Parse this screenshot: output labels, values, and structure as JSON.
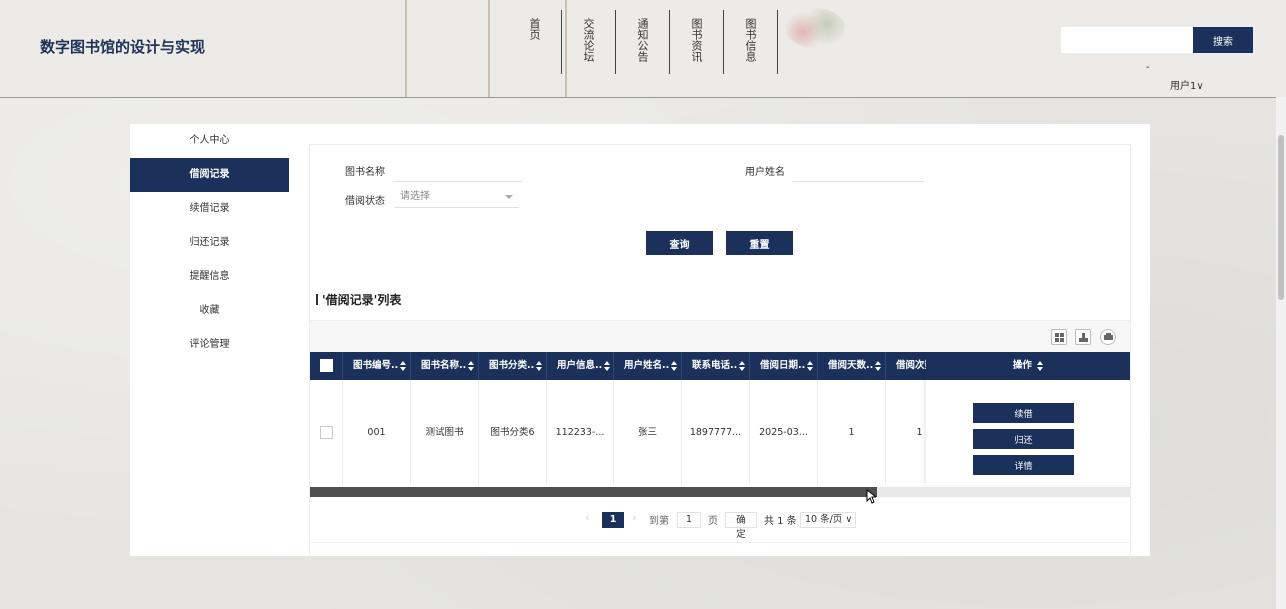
{
  "header": {
    "site_title": "数字图书馆的设计与实现",
    "nav": [
      "首页",
      "交流论坛",
      "通知公告",
      "图书资讯",
      "图书信息"
    ],
    "search_placeholder": "",
    "search_button": "搜索",
    "dash": "-",
    "user_menu": "用户1∨"
  },
  "sidebar": {
    "items": [
      "个人中心",
      "借阅记录",
      "续借记录",
      "归还记录",
      "提醒信息",
      "收藏",
      "评论管理"
    ],
    "active_index": 1
  },
  "filters": {
    "book_name_label": "图书名称",
    "book_name_value": "",
    "user_name_label": "用户姓名",
    "user_name_value": "",
    "status_label": "借阅状态",
    "status_placeholder": "请选择",
    "query_button": "查询",
    "reset_button": "重置"
  },
  "list_title": "'借阅记录'列表",
  "toolbar_icons": [
    "columns-icon",
    "export-icon",
    "print-icon"
  ],
  "table": {
    "headers": [
      "图书编号..",
      "图书名称..",
      "图书分类..",
      "用户信息..",
      "用户姓名..",
      "联系电话..",
      "借阅日期..",
      "借阅天数..",
      "借阅次数"
    ],
    "op_header": "操作",
    "rows": [
      {
        "cells": [
          "001",
          "测试图书",
          "图书分类6",
          "112233-...",
          "张三",
          "1897777...",
          "2025-03...",
          "1",
          "1"
        ],
        "actions": [
          "续借",
          "归还",
          "详情"
        ]
      }
    ]
  },
  "pagination": {
    "prev": "‹",
    "current": "1",
    "next": "›",
    "goto_label": "到第",
    "goto_value": "1",
    "page_unit": "页",
    "confirm": "确定",
    "total": "共 1 条",
    "page_size": "10 条/页 ∨"
  },
  "colors": {
    "primary": "#1b315c",
    "background": "#e6e5e2"
  }
}
